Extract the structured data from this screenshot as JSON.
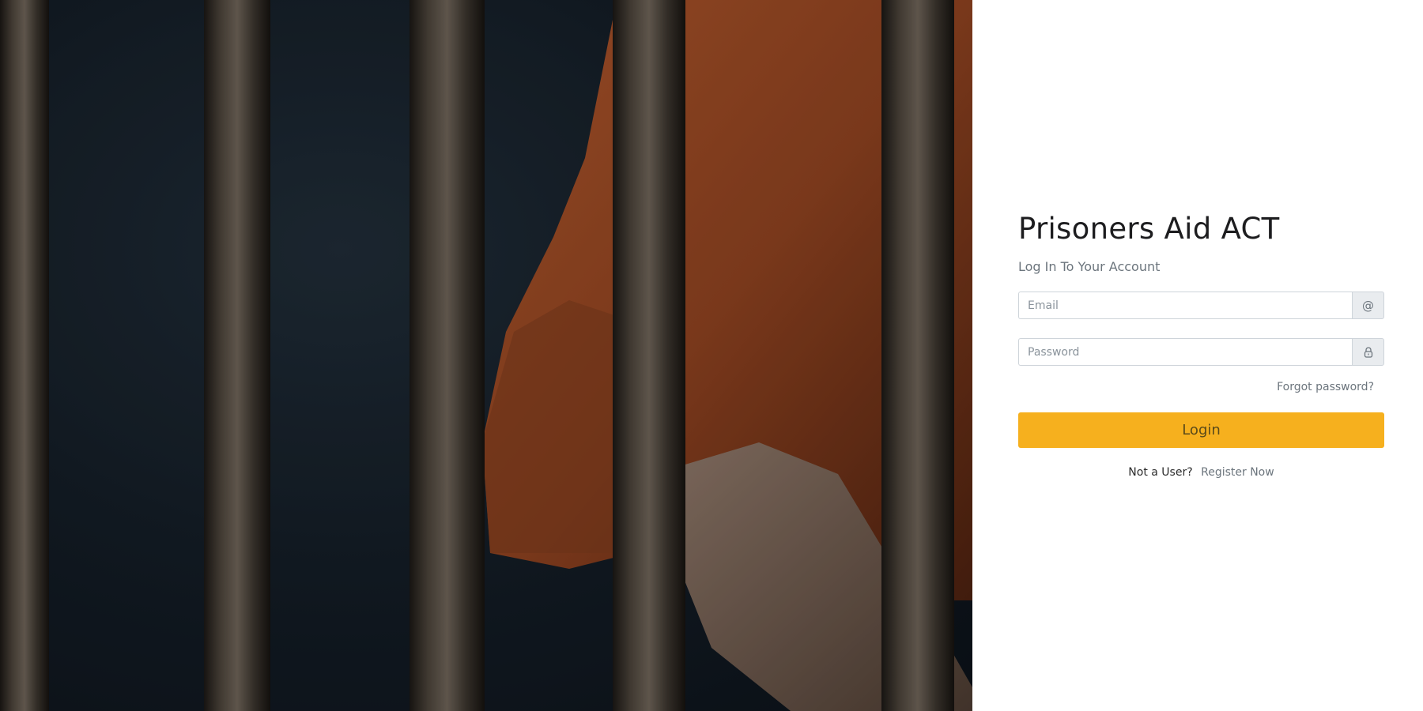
{
  "hero": {
    "image": "jail-bars-prisoner-photo"
  },
  "login": {
    "title": "Prisoners Aid ACT",
    "subtitle": "Log In To Your Account",
    "email": {
      "placeholder": "Email",
      "value": "",
      "icon": "at-icon"
    },
    "password": {
      "placeholder": "Password",
      "value": "",
      "icon": "lock-icon"
    },
    "forgot_label": "Forgot password?",
    "login_label": "Login",
    "not_user_label": "Not a User?",
    "register_label": "Register Now"
  },
  "colors": {
    "accent": "#f6b01e",
    "muted_text": "#6c757d",
    "title_text": "#1d1d1f"
  }
}
